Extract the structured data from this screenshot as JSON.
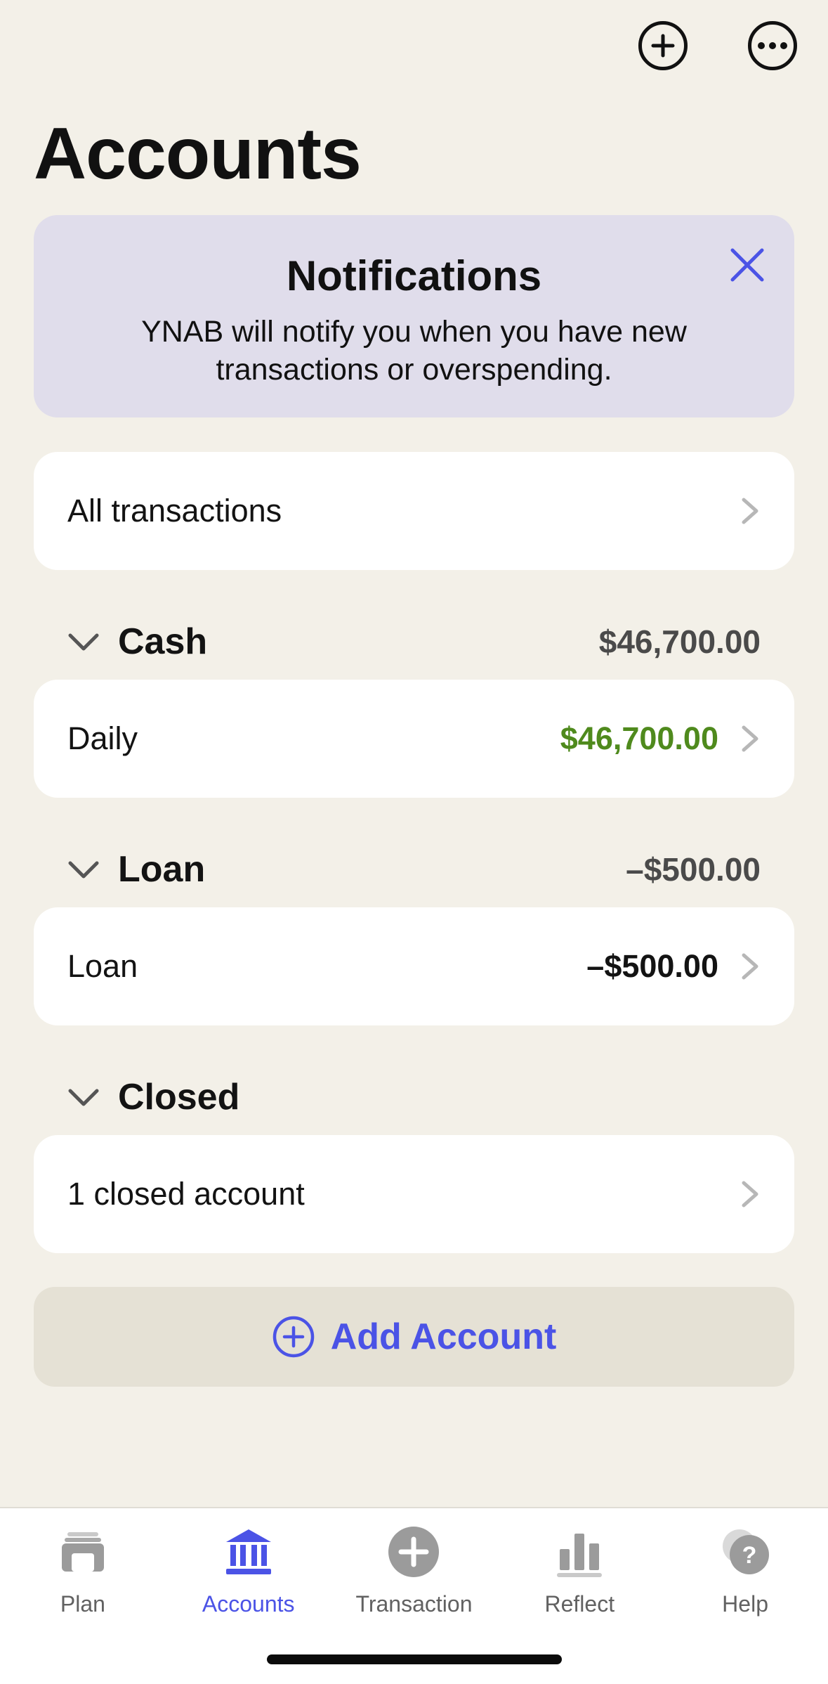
{
  "header": {
    "title": "Accounts",
    "add_icon": "plus-circle-icon",
    "more_icon": "ellipsis-circle-icon"
  },
  "notification": {
    "title": "Notifications",
    "body": "YNAB will notify you when you have new transactions or overspending."
  },
  "all_transactions": {
    "label": "All transactions"
  },
  "sections": [
    {
      "name": "Cash",
      "total": "$46,700.00",
      "accounts": [
        {
          "label": "Daily",
          "amount": "$46,700.00"
        }
      ]
    },
    {
      "name": "Loan",
      "total": "–$500.00",
      "accounts": [
        {
          "label": "Loan",
          "amount": "–$500.00"
        }
      ]
    },
    {
      "name": "Closed",
      "total": "",
      "accounts": [
        {
          "label": "1 closed account",
          "amount": ""
        }
      ]
    }
  ],
  "add_account": {
    "label": "Add Account"
  },
  "tabs": [
    {
      "label": "Plan",
      "icon": "plan-icon"
    },
    {
      "label": "Accounts",
      "icon": "bank-icon",
      "active": true
    },
    {
      "label": "Transaction",
      "icon": "plus-circle-icon"
    },
    {
      "label": "Reflect",
      "icon": "bar-chart-icon"
    },
    {
      "label": "Help",
      "icon": "help-bubble-icon"
    }
  ],
  "colors": {
    "accent": "#4b53e6",
    "positive": "#4f8a1d",
    "background": "#f3f0e8",
    "notification_bg": "#e0ddeb"
  }
}
